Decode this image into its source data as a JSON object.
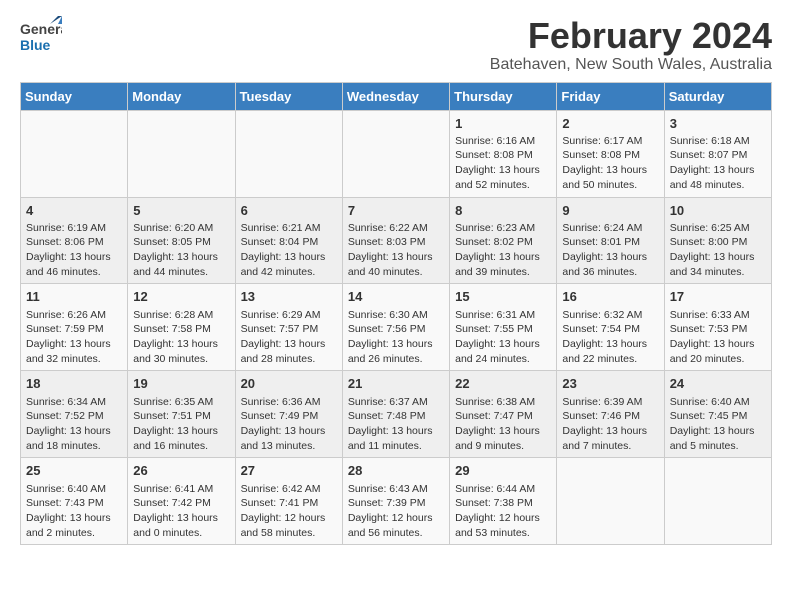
{
  "logo": {
    "text_general": "General",
    "text_blue": "Blue"
  },
  "header": {
    "title": "February 2024",
    "subtitle": "Batehaven, New South Wales, Australia"
  },
  "days_of_week": [
    "Sunday",
    "Monday",
    "Tuesday",
    "Wednesday",
    "Thursday",
    "Friday",
    "Saturday"
  ],
  "weeks": [
    [
      {
        "day": "",
        "content": ""
      },
      {
        "day": "",
        "content": ""
      },
      {
        "day": "",
        "content": ""
      },
      {
        "day": "",
        "content": ""
      },
      {
        "day": "1",
        "content": "Sunrise: 6:16 AM\nSunset: 8:08 PM\nDaylight: 13 hours\nand 52 minutes."
      },
      {
        "day": "2",
        "content": "Sunrise: 6:17 AM\nSunset: 8:08 PM\nDaylight: 13 hours\nand 50 minutes."
      },
      {
        "day": "3",
        "content": "Sunrise: 6:18 AM\nSunset: 8:07 PM\nDaylight: 13 hours\nand 48 minutes."
      }
    ],
    [
      {
        "day": "4",
        "content": "Sunrise: 6:19 AM\nSunset: 8:06 PM\nDaylight: 13 hours\nand 46 minutes."
      },
      {
        "day": "5",
        "content": "Sunrise: 6:20 AM\nSunset: 8:05 PM\nDaylight: 13 hours\nand 44 minutes."
      },
      {
        "day": "6",
        "content": "Sunrise: 6:21 AM\nSunset: 8:04 PM\nDaylight: 13 hours\nand 42 minutes."
      },
      {
        "day": "7",
        "content": "Sunrise: 6:22 AM\nSunset: 8:03 PM\nDaylight: 13 hours\nand 40 minutes."
      },
      {
        "day": "8",
        "content": "Sunrise: 6:23 AM\nSunset: 8:02 PM\nDaylight: 13 hours\nand 39 minutes."
      },
      {
        "day": "9",
        "content": "Sunrise: 6:24 AM\nSunset: 8:01 PM\nDaylight: 13 hours\nand 36 minutes."
      },
      {
        "day": "10",
        "content": "Sunrise: 6:25 AM\nSunset: 8:00 PM\nDaylight: 13 hours\nand 34 minutes."
      }
    ],
    [
      {
        "day": "11",
        "content": "Sunrise: 6:26 AM\nSunset: 7:59 PM\nDaylight: 13 hours\nand 32 minutes."
      },
      {
        "day": "12",
        "content": "Sunrise: 6:28 AM\nSunset: 7:58 PM\nDaylight: 13 hours\nand 30 minutes."
      },
      {
        "day": "13",
        "content": "Sunrise: 6:29 AM\nSunset: 7:57 PM\nDaylight: 13 hours\nand 28 minutes."
      },
      {
        "day": "14",
        "content": "Sunrise: 6:30 AM\nSunset: 7:56 PM\nDaylight: 13 hours\nand 26 minutes."
      },
      {
        "day": "15",
        "content": "Sunrise: 6:31 AM\nSunset: 7:55 PM\nDaylight: 13 hours\nand 24 minutes."
      },
      {
        "day": "16",
        "content": "Sunrise: 6:32 AM\nSunset: 7:54 PM\nDaylight: 13 hours\nand 22 minutes."
      },
      {
        "day": "17",
        "content": "Sunrise: 6:33 AM\nSunset: 7:53 PM\nDaylight: 13 hours\nand 20 minutes."
      }
    ],
    [
      {
        "day": "18",
        "content": "Sunrise: 6:34 AM\nSunset: 7:52 PM\nDaylight: 13 hours\nand 18 minutes."
      },
      {
        "day": "19",
        "content": "Sunrise: 6:35 AM\nSunset: 7:51 PM\nDaylight: 13 hours\nand 16 minutes."
      },
      {
        "day": "20",
        "content": "Sunrise: 6:36 AM\nSunset: 7:49 PM\nDaylight: 13 hours\nand 13 minutes."
      },
      {
        "day": "21",
        "content": "Sunrise: 6:37 AM\nSunset: 7:48 PM\nDaylight: 13 hours\nand 11 minutes."
      },
      {
        "day": "22",
        "content": "Sunrise: 6:38 AM\nSunset: 7:47 PM\nDaylight: 13 hours\nand 9 minutes."
      },
      {
        "day": "23",
        "content": "Sunrise: 6:39 AM\nSunset: 7:46 PM\nDaylight: 13 hours\nand 7 minutes."
      },
      {
        "day": "24",
        "content": "Sunrise: 6:40 AM\nSunset: 7:45 PM\nDaylight: 13 hours\nand 5 minutes."
      }
    ],
    [
      {
        "day": "25",
        "content": "Sunrise: 6:40 AM\nSunset: 7:43 PM\nDaylight: 13 hours\nand 2 minutes."
      },
      {
        "day": "26",
        "content": "Sunrise: 6:41 AM\nSunset: 7:42 PM\nDaylight: 13 hours\nand 0 minutes."
      },
      {
        "day": "27",
        "content": "Sunrise: 6:42 AM\nSunset: 7:41 PM\nDaylight: 12 hours\nand 58 minutes."
      },
      {
        "day": "28",
        "content": "Sunrise: 6:43 AM\nSunset: 7:39 PM\nDaylight: 12 hours\nand 56 minutes."
      },
      {
        "day": "29",
        "content": "Sunrise: 6:44 AM\nSunset: 7:38 PM\nDaylight: 12 hours\nand 53 minutes."
      },
      {
        "day": "",
        "content": ""
      },
      {
        "day": "",
        "content": ""
      }
    ]
  ]
}
